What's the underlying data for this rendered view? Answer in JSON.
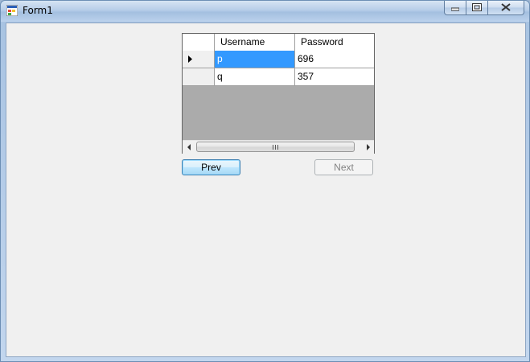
{
  "window": {
    "title": "Form1",
    "controls": [
      "minimize-icon",
      "restore-icon",
      "close-icon"
    ]
  },
  "grid": {
    "columns": [
      "Username",
      "Password"
    ],
    "rows": [
      {
        "username": "p",
        "password": "696",
        "current": true
      },
      {
        "username": "q",
        "password": "357",
        "current": false
      }
    ],
    "scroll_grip": "III"
  },
  "buttons": {
    "prev_label": "Prev",
    "next_label": "Next"
  },
  "colors": {
    "selection": "#3399ff",
    "grid_background": "#ababab",
    "form_background": "#f0f0f0"
  }
}
